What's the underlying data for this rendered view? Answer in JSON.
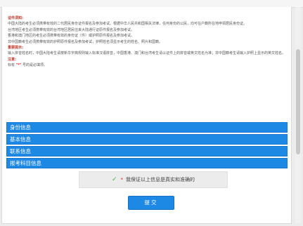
{
  "notice": {
    "heading1": "证件须知:",
    "line1": "中国大陆的考生必须携带有效的二代居民身份证件报名及参加考试。根据中华人民共和国相关法律，任何身份的公民，均可在户籍所在地申领居民身份证。",
    "line2": "台湾地区考生必须携带有效的台湾地区居民往来大陆通行证原件报名及参加考试。",
    "line3": "香港和澳门地区的考生必须携带有效的身份证（件）或护照原件报名及参加考试。",
    "line4": "非中国籍考生必须携带有效的护照原件报名及参加考试，护照姓名须显示考生的姓名、照片和国籍。",
    "heading2": "重要提示:",
    "line5": "输入拼音姓名时，中国大陆考生请按新华字典规则输入标准汉语拼音，中国香港、澳门和台湾考生请以证件上的拼音或英文姓名为准；非中国籍考生请输入护照上显示的英文姓名。",
    "heading3": "注意:",
    "required_prefix": "标有",
    "required_star": "\"*\"",
    "required_suffix": "号的是必填项。"
  },
  "sections": [
    "身份信息",
    "基本信息",
    "联系信息",
    "报考科目信息"
  ],
  "confirm": {
    "check_icon": "✓",
    "star": "*",
    "text": "我保证以上信息是真实和准确的"
  },
  "submit_label": "提交"
}
